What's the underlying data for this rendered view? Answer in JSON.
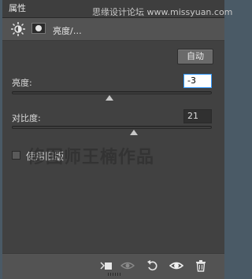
{
  "panel": {
    "tab_label": "属性",
    "header_title": "亮度/…",
    "watermark_top": "思缘设计论坛 www.missyuan.com",
    "watermark_mid": "修图师王楠作品"
  },
  "controls": {
    "auto_label": "自动",
    "brightness_label": "亮度:",
    "brightness_value": "-3",
    "brightness_fraction": 0.49,
    "contrast_label": "对比度:",
    "contrast_value": "21",
    "contrast_fraction": 0.61,
    "legacy_label": "使用旧版",
    "legacy_checked": false
  },
  "icons": {
    "adjustment": "brightness-sun-icon",
    "mask": "layer-mask-icon",
    "clip": "clip-to-layer-icon",
    "view_previous": "view-previous-state-icon",
    "reset": "reset-icon",
    "visibility": "eye-icon",
    "delete": "trash-icon"
  }
}
